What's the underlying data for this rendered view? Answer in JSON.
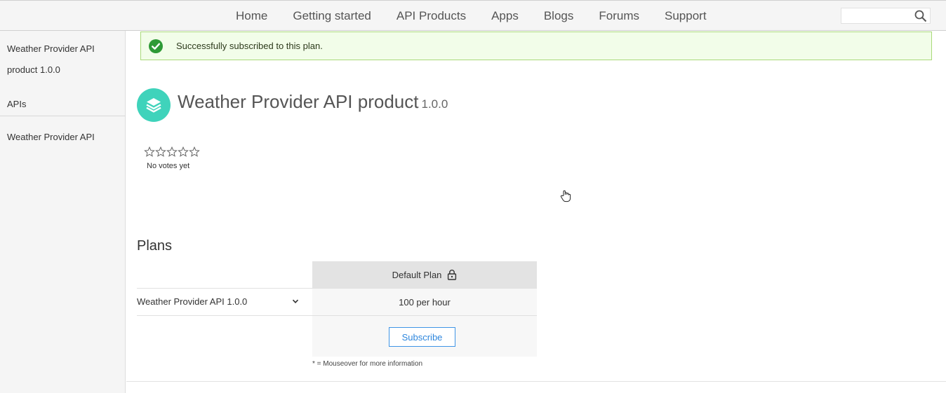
{
  "nav": {
    "items": [
      {
        "label": "Home"
      },
      {
        "label": "Getting started"
      },
      {
        "label": "API Products"
      },
      {
        "label": "Apps"
      },
      {
        "label": "Blogs"
      },
      {
        "label": "Forums"
      },
      {
        "label": "Support"
      }
    ],
    "search": {
      "value": "",
      "icon": "search-icon"
    }
  },
  "sidebar": {
    "product_link": "Weather Provider API product 1.0.0",
    "apis_heading": "APIs",
    "api_link": "Weather Provider API"
  },
  "alert": {
    "text": "Successfully subscribed to this plan.",
    "icon": "check-circle-icon",
    "color": "#2e9a36"
  },
  "product": {
    "title": "Weather Provider API product",
    "version": "1.0.0",
    "icon": "layers-icon",
    "accent_color": "#3fd3bb"
  },
  "rating": {
    "stars_total": 5,
    "stars_filled": 0,
    "votes_text": "No votes yet"
  },
  "plans": {
    "title": "Plans",
    "plan_name": "Default Plan",
    "plan_icon": "lock-icon",
    "row_label": "Weather Provider API 1.0.0",
    "rate_limit": "100 per hour",
    "subscribe_label": "Subscribe",
    "footnote": "* = Mouseover for more information"
  }
}
